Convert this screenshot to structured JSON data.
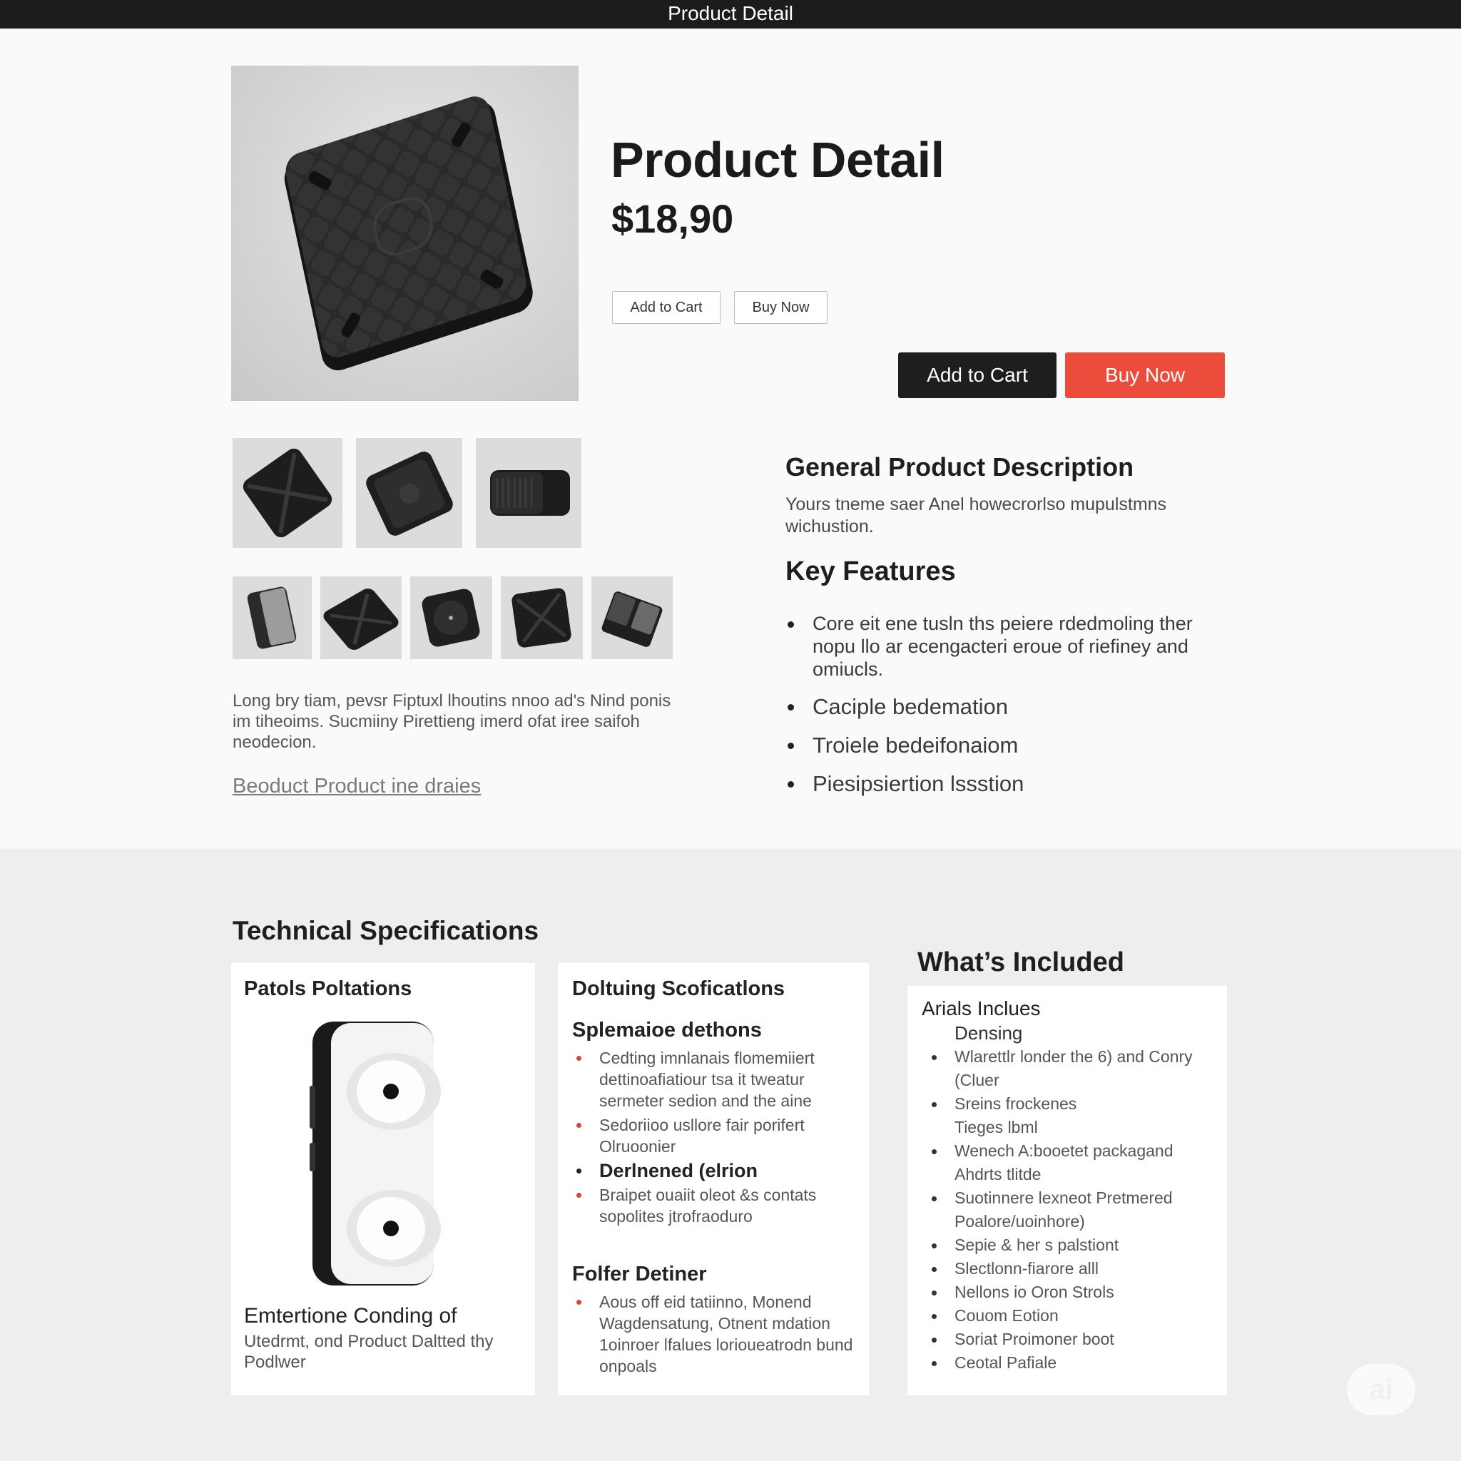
{
  "window": {
    "title": "Product Detail"
  },
  "product": {
    "title": "Product Detail",
    "price": "$18,90",
    "buttons": {
      "add_to_cart_small": "Add to Cart",
      "buy_now_small": "Buy Now",
      "add_to_cart": "Add to Cart",
      "buy_now": "Buy Now"
    },
    "long_description": "Long bry tiam, pevsr Fiptuxl lhoutins nnoo ad's Nind ponis im tiheoims. Sucmiiny Pirettieng imerd ofat iree saifoh neodecion.",
    "details_link": "Beoduct Product ine draies"
  },
  "description": {
    "heading": "General Product Description",
    "text": "Yours tneme saer Anel howecrorlso mupulstmns wichustion."
  },
  "features": {
    "heading": "Key Features",
    "items": [
      "Core eit ene tusln ths peiere rdedmoling ther nopu llo ar ecengacteri eroue of riefiney and omiucls.",
      "Caciple bedemation",
      "Troiele bedeifonaiom",
      "Piesipsiertion lssstion"
    ]
  },
  "specs": {
    "heading": "Technical Specifications",
    "card1": {
      "title": "Patols Poltations",
      "caption_title": "Emtertione Conding of",
      "caption_text": "Utedrmt, ond Product Daltted thy Podlwer"
    },
    "card2": {
      "title": "Doltuing Scoficatlons",
      "section1_title": "Splemaioe dethons",
      "section1_items": [
        "Cedting imnlanais flomemiiert dettinoafiatiour tsa it tweatur sermeter sedion and the aine",
        "Sedoriioo usllore fair porifert Olruoonier"
      ],
      "bold_item": "Derlnened (elrion",
      "section1_items_after": [
        "Braipet ouaiit oleot &s contats sopolites jtrofraoduro"
      ],
      "section2_title": "Folfer Detiner",
      "section2_items": [
        "Aous off eid tatiinno, Monend Wagdensatung, Otnent mdation 1oinroer lfalues lorioueatrodn bund onpoals"
      ]
    }
  },
  "included": {
    "heading": "What’s Included",
    "card_title": "Arials Inclues",
    "items": [
      {
        "text": "Densing",
        "bullet": false
      },
      {
        "text": "Wlarettlr londer the 6) and Conry (Cluer",
        "bullet": true
      },
      {
        "text": "Sreins frockenes",
        "bullet": true
      },
      {
        "text": "Tieges lbml",
        "bullet": false
      },
      {
        "text": "Wenech A:booetet packagand Ahdrts tlitde",
        "bullet": true
      },
      {
        "text": "Suotinnere lexneot Pretmered Poalore/uoinhore)",
        "bullet": true
      },
      {
        "text": "Sepie & her s palstiont",
        "bullet": true
      },
      {
        "text": "Slectlonn-fiarore alll",
        "bullet": true
      },
      {
        "text": "Nellons io Oron Strols",
        "bullet": true
      },
      {
        "text": "Couom Eotion",
        "bullet": true
      },
      {
        "text": "Soriat Proimoner boot",
        "bullet": true
      },
      {
        "text": "Ceotal Pafiale",
        "bullet": true
      }
    ]
  },
  "watermark": "ai",
  "colors": {
    "topbar": "#1c1c1c",
    "accent_red": "#ec4c3c",
    "dark_button": "#1e1e1e",
    "spec_bullet": "#d9433a"
  }
}
